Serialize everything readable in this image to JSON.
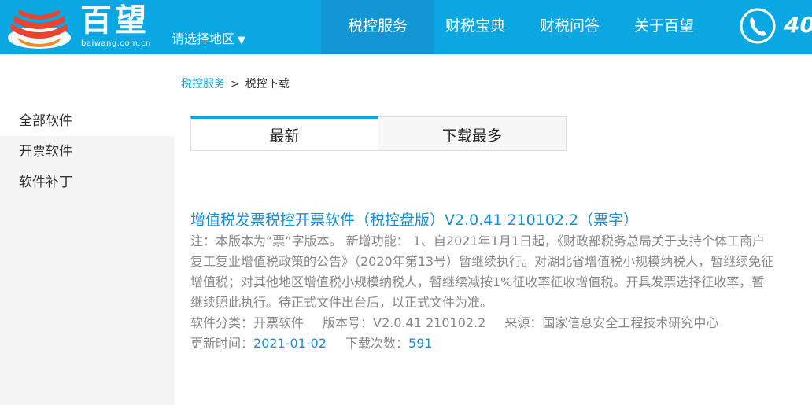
{
  "header": {
    "logo_text": "百望",
    "logo_domain": "baiwang.com.cn",
    "region_label": "请选择地区",
    "region_caret": "▼",
    "nav": [
      {
        "label": "税控服务",
        "active": true
      },
      {
        "label": "财税宝典",
        "active": false
      },
      {
        "label": "财税问答",
        "active": false
      },
      {
        "label": "关于百望",
        "active": false
      }
    ],
    "phone_text": "40",
    "brand_color": "#0aa7e3"
  },
  "breadcrumb": {
    "root": "税控服务",
    "separator": ">",
    "current": "税控下载"
  },
  "sidebar": {
    "items": [
      {
        "label": "全部软件",
        "active": true
      },
      {
        "label": "开票软件",
        "active": false
      },
      {
        "label": "软件补丁",
        "active": false
      }
    ]
  },
  "tabs": [
    {
      "label": "最新",
      "active": true
    },
    {
      "label": "下载最多",
      "active": false
    }
  ],
  "article": {
    "title": "增值税发票税控开票软件（税控盘版）V2.0.41 210102.2（票字）",
    "description": "注：本版本为“票”字版本。 新增功能： 1、自2021年1月1日起，《财政部税务总局关于支持个体工商户复工复业增值税政策的公告》（2020年第13号）暂继续执行。对湖北省增值税小规模纳税人，暂继续免征增值税；对其他地区增值税小规模纳税人，暂继续减按1%征收率征收增值税。开具发票选择征收率，暂继续照此执行。待正式文件出台后，以正式文件为准。",
    "category_label": "软件分类：",
    "category_value": "开票软件",
    "version_label": "版本号：",
    "version_value": "V2.0.41 210102.2",
    "source_label": "来源：",
    "source_value": "国家信息安全工程技术研究中心",
    "updated_label": "更新时间：",
    "updated_value": "2021-01-02",
    "downloads_label": "下载次数：",
    "downloads_value": "591"
  }
}
